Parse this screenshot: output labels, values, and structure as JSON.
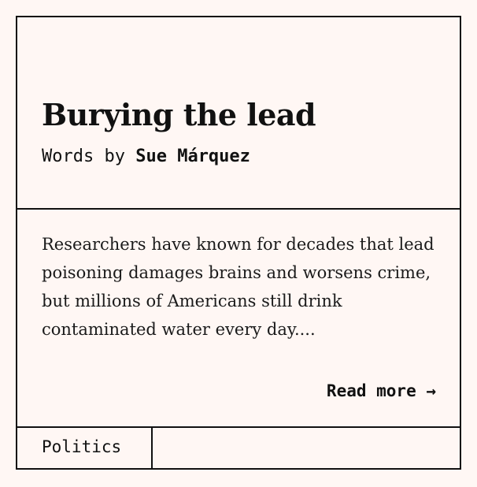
{
  "article": {
    "title": "Burying the lead",
    "byline_prefix": "Words by ",
    "author": "Sue Márquez",
    "excerpt": "Researchers have known for decades that lead poisoning damages brains and worsens crime, but millions of Americans still drink contaminated water every day....",
    "read_more": "Read more →",
    "category": "Politics"
  },
  "colors": {
    "background": "#fff7f4",
    "border": "#111111",
    "text": "#111111"
  }
}
